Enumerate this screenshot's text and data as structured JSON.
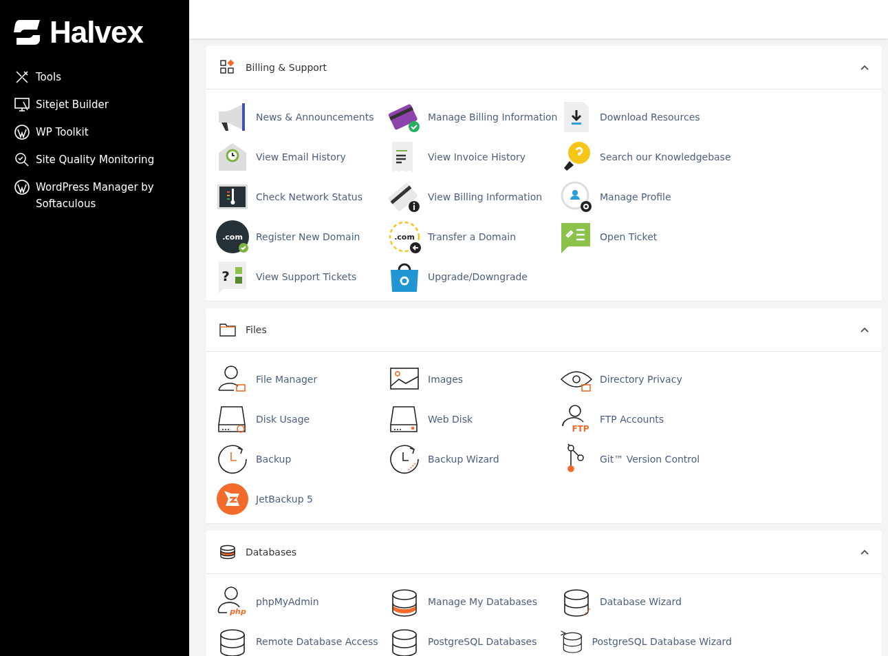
{
  "brand": {
    "name": "Halvex"
  },
  "sidebar": {
    "items": [
      {
        "label": "Tools"
      },
      {
        "label": "Sitejet Builder"
      },
      {
        "label": "WP Toolkit"
      },
      {
        "label": "Site Quality Monitoring"
      },
      {
        "label": "WordPress Manager by Softaculous"
      }
    ]
  },
  "sections": [
    {
      "title": "Billing & Support",
      "expanded": true,
      "items": [
        {
          "label": "News & Announcements"
        },
        {
          "label": "Manage Billing Information"
        },
        {
          "label": "Download Resources"
        },
        {
          "label": "View Email History"
        },
        {
          "label": "View Invoice History"
        },
        {
          "label": "Search our Knowledgebase"
        },
        {
          "label": "Check Network Status"
        },
        {
          "label": "View Billing Information"
        },
        {
          "label": "Manage Profile"
        },
        {
          "label": "Register New Domain",
          "icon_label": ".com"
        },
        {
          "label": "Transfer a Domain",
          "icon_label": ".com"
        },
        {
          "label": "Open Ticket"
        },
        {
          "label": "View Support Tickets",
          "icon_label": "?"
        },
        {
          "label": "Upgrade/Downgrade"
        }
      ]
    },
    {
      "title": "Files",
      "expanded": true,
      "items": [
        {
          "label": "File Manager"
        },
        {
          "label": "Images"
        },
        {
          "label": "Directory Privacy"
        },
        {
          "label": "Disk Usage"
        },
        {
          "label": "Web Disk"
        },
        {
          "label": "FTP Accounts",
          "icon_label": "FTP"
        },
        {
          "label": "Backup"
        },
        {
          "label": "Backup Wizard"
        },
        {
          "label": "Git™ Version Control"
        },
        {
          "label": "JetBackup 5"
        }
      ]
    },
    {
      "title": "Databases",
      "expanded": true,
      "items": [
        {
          "label": "phpMyAdmin",
          "icon_label": "php"
        },
        {
          "label": "Manage My Databases"
        },
        {
          "label": "Database Wizard"
        },
        {
          "label": "Remote Database Access"
        },
        {
          "label": "PostgreSQL Databases"
        },
        {
          "label": "PostgreSQL Database Wizard"
        }
      ]
    }
  ]
}
